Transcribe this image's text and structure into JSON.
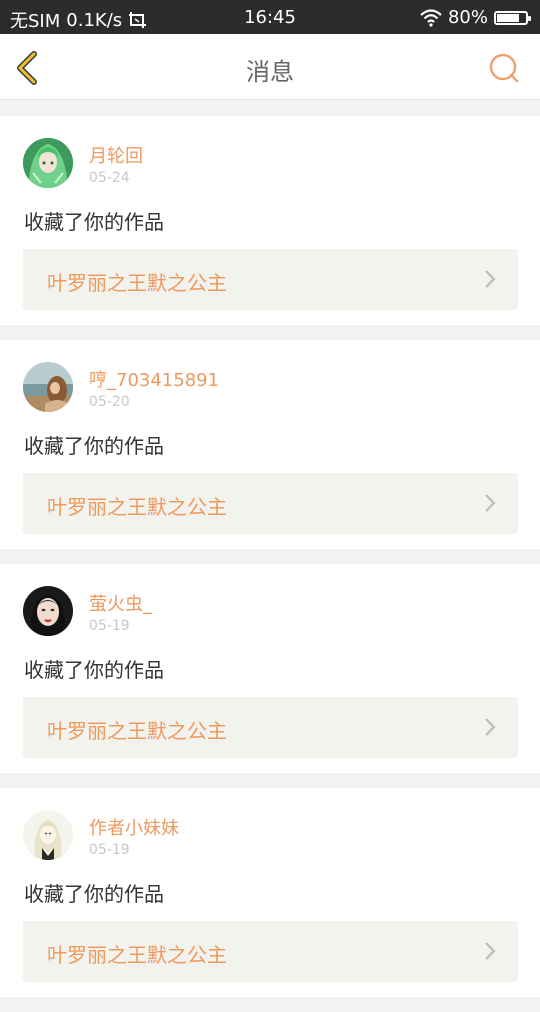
{
  "status_bar": {
    "carrier": "无SIM",
    "speed": "0.1K/s",
    "time": "16:45",
    "battery": "80%",
    "battery_level": 0.8
  },
  "nav": {
    "title": "消息",
    "accent": "#f0c030",
    "search_color": "#f0a070"
  },
  "colors": {
    "username": "#ee9a5f",
    "work_title": "#ee9a5f",
    "date": "#c8c8c8",
    "work_box_bg": "#f3f3ee"
  },
  "messages": [
    {
      "username": "月轮回",
      "date": "05-24",
      "action": "收藏了你的作品",
      "work": "叶罗丽之王默之公主",
      "avatar": "green-haired-anime-avatar"
    },
    {
      "username": "哼_703415891",
      "date": "05-20",
      "action": "收藏了你的作品",
      "work": "叶罗丽之王默之公主",
      "avatar": "seaside-girl-avatar"
    },
    {
      "username": "萤火虫_",
      "date": "05-19",
      "action": "收藏了你的作品",
      "work": "叶罗丽之王默之公主",
      "avatar": "woman-portrait-avatar"
    },
    {
      "username": "作者小妹妹",
      "date": "05-19",
      "action": "收藏了你的作品",
      "work": "叶罗丽之王默之公主",
      "avatar": "anime-girl-sketch-avatar"
    }
  ]
}
